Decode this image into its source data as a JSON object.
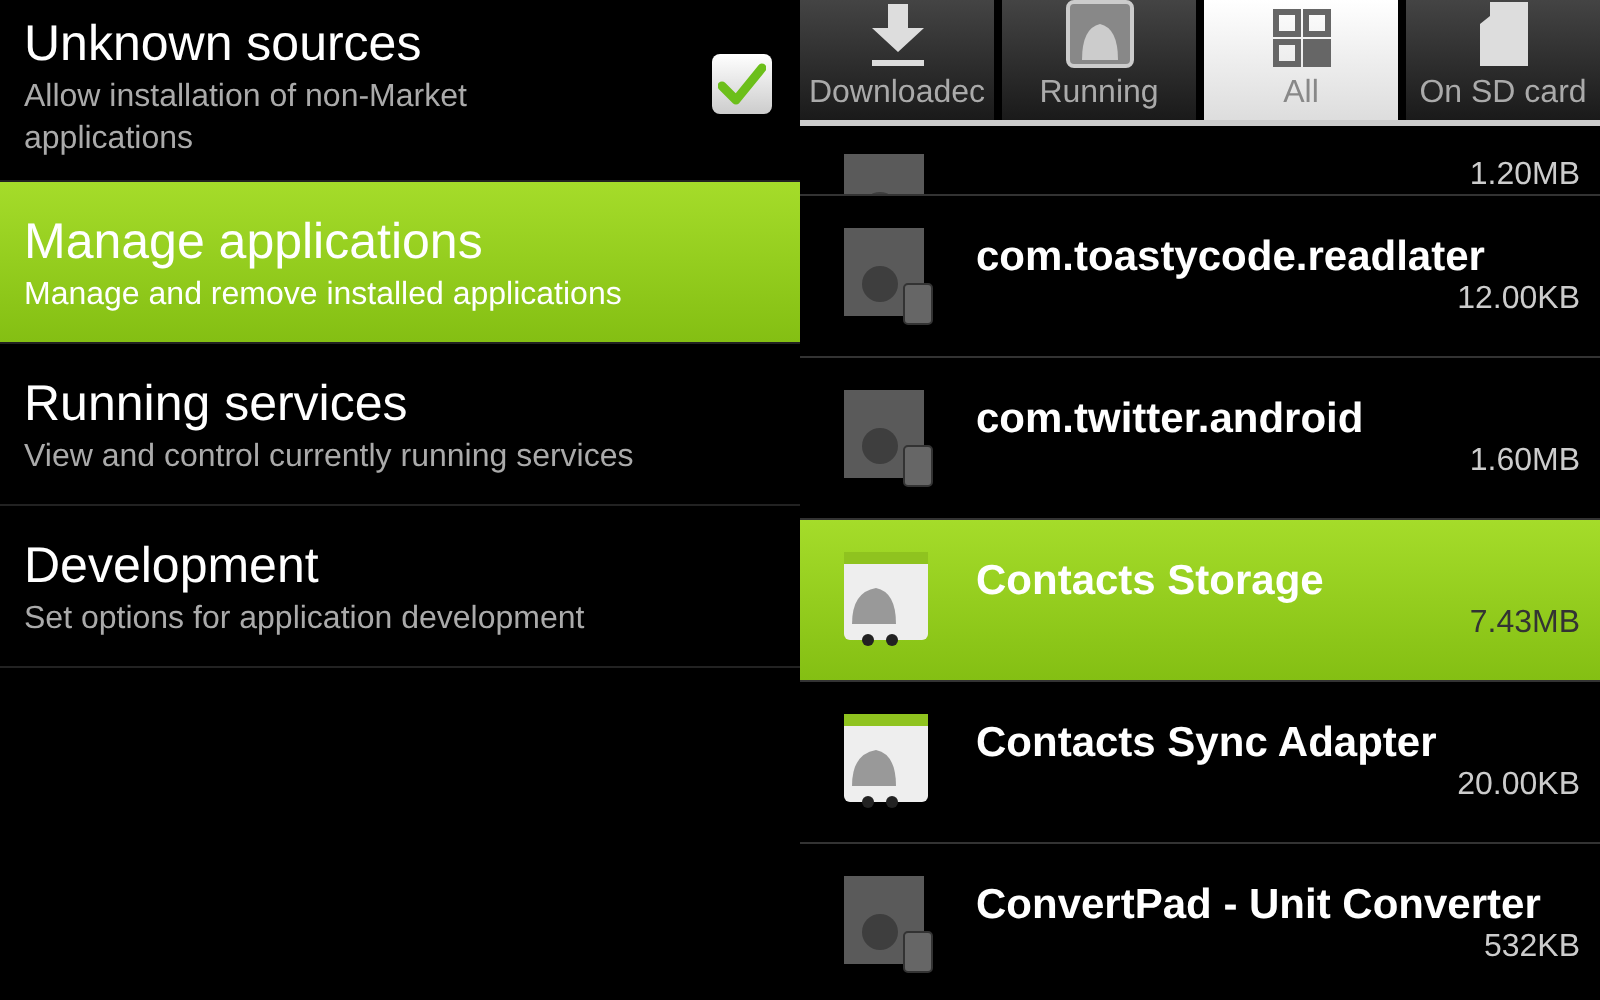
{
  "settings": [
    {
      "title": "Unknown sources",
      "summary": "Allow installation of non-Market applications",
      "checked": true,
      "selected": false
    },
    {
      "title": "Manage applications",
      "summary": "Manage and remove installed applications",
      "selected": true
    },
    {
      "title": "Running services",
      "summary": "View and control currently running services",
      "selected": false
    },
    {
      "title": "Development",
      "summary": "Set options for application development",
      "selected": false
    }
  ],
  "tabs": [
    {
      "label": "Downloadec",
      "selected": false
    },
    {
      "label": "Running",
      "selected": false
    },
    {
      "label": "All",
      "selected": true
    },
    {
      "label": "On SD card",
      "selected": false
    }
  ],
  "apps": [
    {
      "size": "1.20MB",
      "kind": "sd",
      "selected": false
    },
    {
      "name": "com.toastycode.readlater",
      "size": "12.00KB",
      "kind": "sd",
      "selected": false
    },
    {
      "name": "com.twitter.android",
      "size": "1.60MB",
      "kind": "sd",
      "selected": false
    },
    {
      "name": "Contacts Storage",
      "size": "7.43MB",
      "kind": "system",
      "selected": true
    },
    {
      "name": "Contacts Sync Adapter",
      "size": "20.00KB",
      "kind": "system",
      "selected": false
    },
    {
      "name": "ConvertPad - Unit Converter",
      "size": "532KB",
      "kind": "sd",
      "selected": false
    }
  ]
}
